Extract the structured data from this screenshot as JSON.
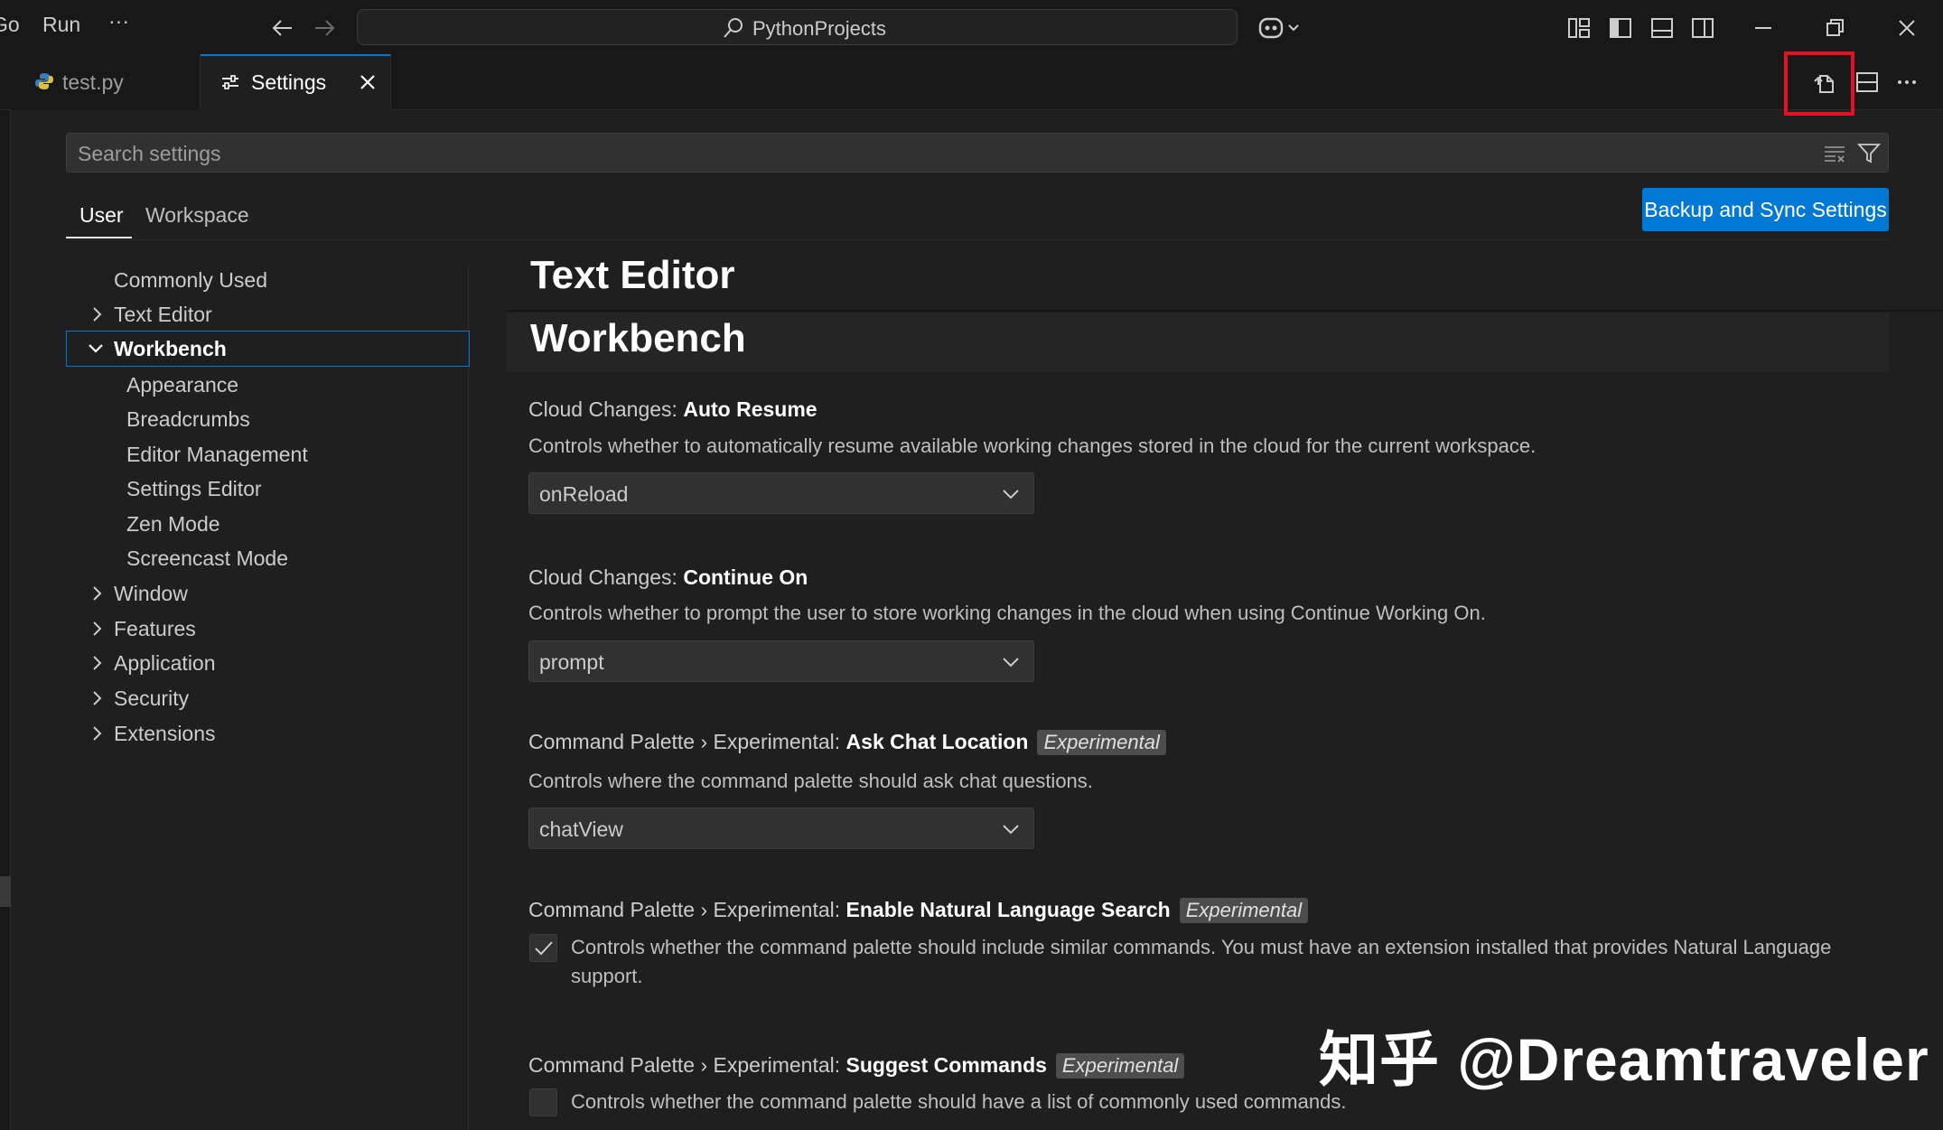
{
  "titlebar": {
    "menu": [
      "Go",
      "Run"
    ],
    "more": "···",
    "search_text": "PythonProjects"
  },
  "tabs": [
    {
      "label": "test.py"
    },
    {
      "label": "Settings"
    }
  ],
  "settings": {
    "search_placeholder": "Search settings",
    "scopes": [
      "User",
      "Workspace"
    ],
    "sync_button": "Backup and Sync Settings",
    "toc": {
      "commonly_used": "Commonly Used",
      "text_editor": "Text Editor",
      "workbench": "Workbench",
      "workbench_children": [
        "Appearance",
        "Breadcrumbs",
        "Editor Management",
        "Settings Editor",
        "Zen Mode",
        "Screencast Mode"
      ],
      "window": "Window",
      "features": "Features",
      "application": "Application",
      "security": "Security",
      "extensions": "Extensions"
    },
    "headings": {
      "text_editor": "Text Editor",
      "workbench": "Workbench"
    },
    "items": [
      {
        "prefix": "Cloud Changes: ",
        "key": "Auto Resume",
        "description": "Controls whether to automatically resume available working changes stored in the cloud for the current workspace.",
        "value": "onReload"
      },
      {
        "prefix": "Cloud Changes: ",
        "key": "Continue On",
        "description": "Controls whether to prompt the user to store working changes in the cloud when using Continue Working On.",
        "value": "prompt"
      },
      {
        "prefix": "Command Palette › Experimental: ",
        "key": "Ask Chat Location",
        "badge": "Experimental",
        "description": "Controls where the command palette should ask chat questions.",
        "value": "chatView"
      },
      {
        "prefix": "Command Palette › Experimental: ",
        "key": "Enable Natural Language Search",
        "badge": "Experimental",
        "description": "Controls whether the command palette should include similar commands. You must have an extension installed that provides Natural Language support.",
        "checked": true
      },
      {
        "prefix": "Command Palette › Experimental: ",
        "key": "Suggest Commands",
        "badge": "Experimental",
        "description": "Controls whether the command palette should have a list of commonly used commands.",
        "checked": false
      }
    ]
  },
  "watermark": "知乎 @Dreamtraveler",
  "colors": {
    "accent": "#0078d4",
    "highlight": "#e81123",
    "background": "#1f1f1f"
  }
}
